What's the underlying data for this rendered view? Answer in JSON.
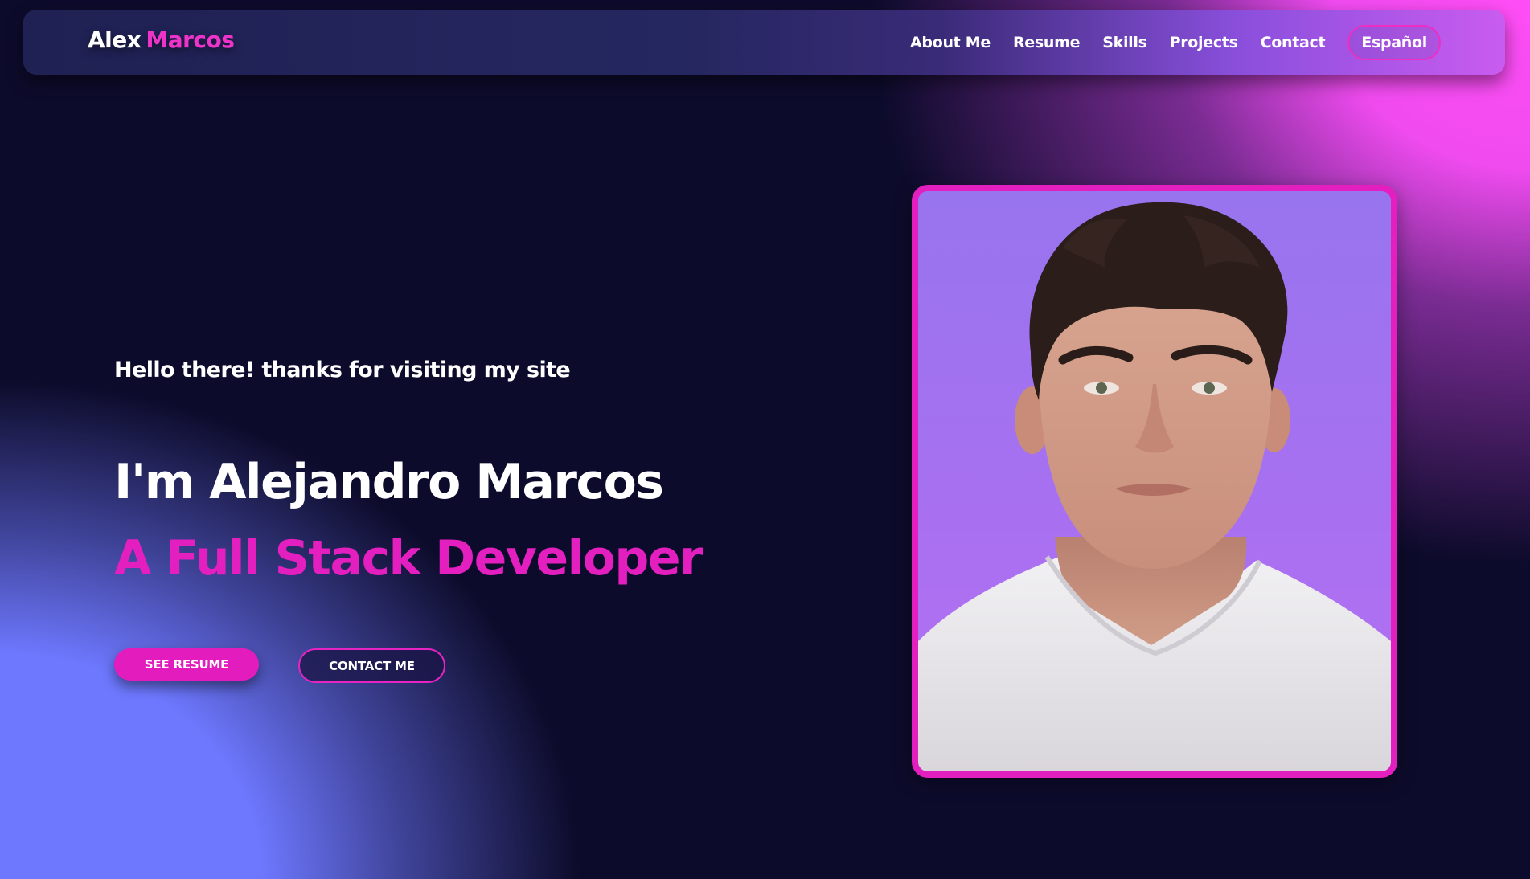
{
  "nav": {
    "brand_first": "Alex",
    "brand_last": "Marcos",
    "links": [
      "About Me",
      "Resume",
      "Skills",
      "Projects",
      "Contact"
    ],
    "language_button": "Español"
  },
  "hero": {
    "greeting": "Hello there! thanks for visiting my site",
    "name_line": "I'm Alejandro Marcos",
    "role_line": "A Full Stack Developer",
    "primary_button": "SEE RESUME",
    "secondary_button": "CONTACT ME"
  },
  "photo": {
    "subject": "portrait-of-young-man-in-white-t-shirt"
  },
  "colors": {
    "accent": "#e41fbf",
    "background": "#0d0b2b",
    "glow_blue": "#6e78ff",
    "glow_pink": "#ff4df6"
  }
}
